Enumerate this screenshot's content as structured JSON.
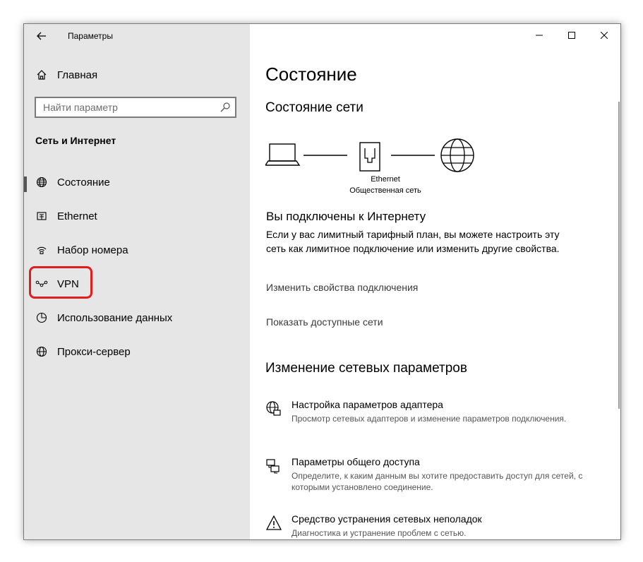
{
  "window": {
    "title": "Параметры",
    "controls": {
      "minimize": "minimize",
      "maximize": "maximize",
      "close": "close"
    }
  },
  "sidebar": {
    "home_label": "Главная",
    "search_placeholder": "Найти параметр",
    "section_title": "Сеть и Интернет",
    "items": [
      {
        "label": "Состояние",
        "icon": "globe-icon",
        "selected": true
      },
      {
        "label": "Ethernet",
        "icon": "ethernet-icon"
      },
      {
        "label": "Набор номера",
        "icon": "dialup-icon"
      },
      {
        "label": "VPN",
        "icon": "vpn-icon",
        "highlighted": true
      },
      {
        "label": "Использование данных",
        "icon": "data-usage-icon"
      },
      {
        "label": "Прокси-сервер",
        "icon": "proxy-icon"
      }
    ],
    "highlight_color": "#e01e1e"
  },
  "main": {
    "title": "Состояние",
    "network_status_title": "Состояние сети",
    "diagram": {
      "adapter_label": "Ethernet",
      "network_label": "Общественная сеть"
    },
    "connected_title": "Вы подключены к Интернету",
    "connected_desc": "Если у вас лимитный тарифный план, вы можете настроить эту сеть как лимитное подключение или изменить другие свойства.",
    "link_change_props": "Изменить свойства подключения",
    "link_show_networks": "Показать доступные сети",
    "change_section_title": "Изменение сетевых параметров",
    "tools": [
      {
        "title": "Настройка параметров адаптера",
        "desc": "Просмотр сетевых адаптеров и изменение параметров подключения.",
        "icon": "adapter-icon"
      },
      {
        "title": "Параметры общего доступа",
        "desc": "Определите, к каким данным вы хотите предоставить доступ для сетей, с которыми установлено соединение.",
        "icon": "sharing-icon"
      },
      {
        "title": "Средство устранения сетевых неполадок",
        "desc": "Диагностика и устранение проблем с сетью.",
        "icon": "warning-icon"
      }
    ]
  }
}
